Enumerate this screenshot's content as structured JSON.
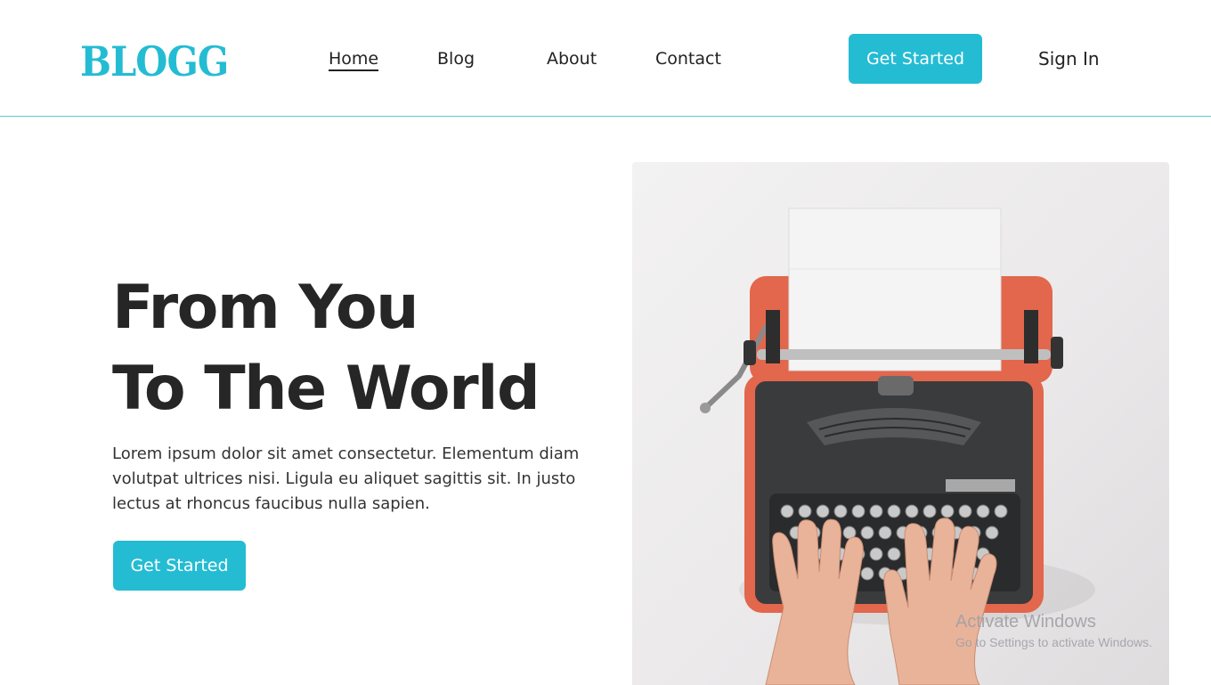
{
  "header": {
    "logo": "BLOGG",
    "nav": [
      {
        "label": "Home",
        "active": true
      },
      {
        "label": "Blog"
      },
      {
        "label": "About"
      },
      {
        "label": "Contact"
      }
    ],
    "cta_label": "Get Started",
    "signin_label": "Sign In"
  },
  "hero": {
    "title_line1": "From You",
    "title_line2": "To The World",
    "description": "Lorem ipsum dolor sit amet consectetur. Elementum diam volutpat ultrices nisi. Ligula eu aliquet sagittis sit. In justo lectus at rhoncus faucibus nulla sapien.",
    "cta_label": "Get Started",
    "image_subject": "typewriter-photo"
  },
  "watermark": {
    "title": "Activate Windows",
    "subtitle": "Go to Settings to activate Windows."
  },
  "colors": {
    "accent": "#24bcd3",
    "text_dark": "#262626",
    "typewriter_body": "#e2674c",
    "typewriter_panel": "#3a3b3d"
  }
}
